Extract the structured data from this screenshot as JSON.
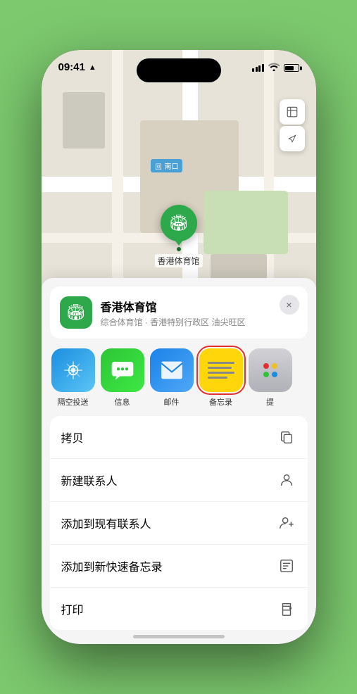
{
  "status_bar": {
    "time": "09:41",
    "location_icon": "▲"
  },
  "map": {
    "label": "南口",
    "label_prefix": "回",
    "controls": {
      "map_type_icon": "🗺",
      "location_icon": "➤"
    }
  },
  "venue_pin": {
    "name": "香港体育馆",
    "icon": "🏟"
  },
  "info_card": {
    "title": "香港体育馆",
    "subtitle": "综合体育馆 · 香港特别行政区 油尖旺区",
    "close": "×"
  },
  "share_items": [
    {
      "id": "airdrop",
      "label": "隔空投送",
      "type": "airdrop"
    },
    {
      "id": "messages",
      "label": "信息",
      "type": "messages"
    },
    {
      "id": "mail",
      "label": "邮件",
      "type": "mail"
    },
    {
      "id": "notes",
      "label": "备忘录",
      "type": "notes"
    },
    {
      "id": "more",
      "label": "提",
      "type": "more"
    }
  ],
  "action_items": [
    {
      "id": "copy",
      "label": "拷贝",
      "icon": "copy"
    },
    {
      "id": "new-contact",
      "label": "新建联系人",
      "icon": "person"
    },
    {
      "id": "add-contact",
      "label": "添加到现有联系人",
      "icon": "person-add"
    },
    {
      "id": "quick-note",
      "label": "添加到新快速备忘录",
      "icon": "note"
    },
    {
      "id": "print",
      "label": "打印",
      "icon": "print"
    }
  ]
}
